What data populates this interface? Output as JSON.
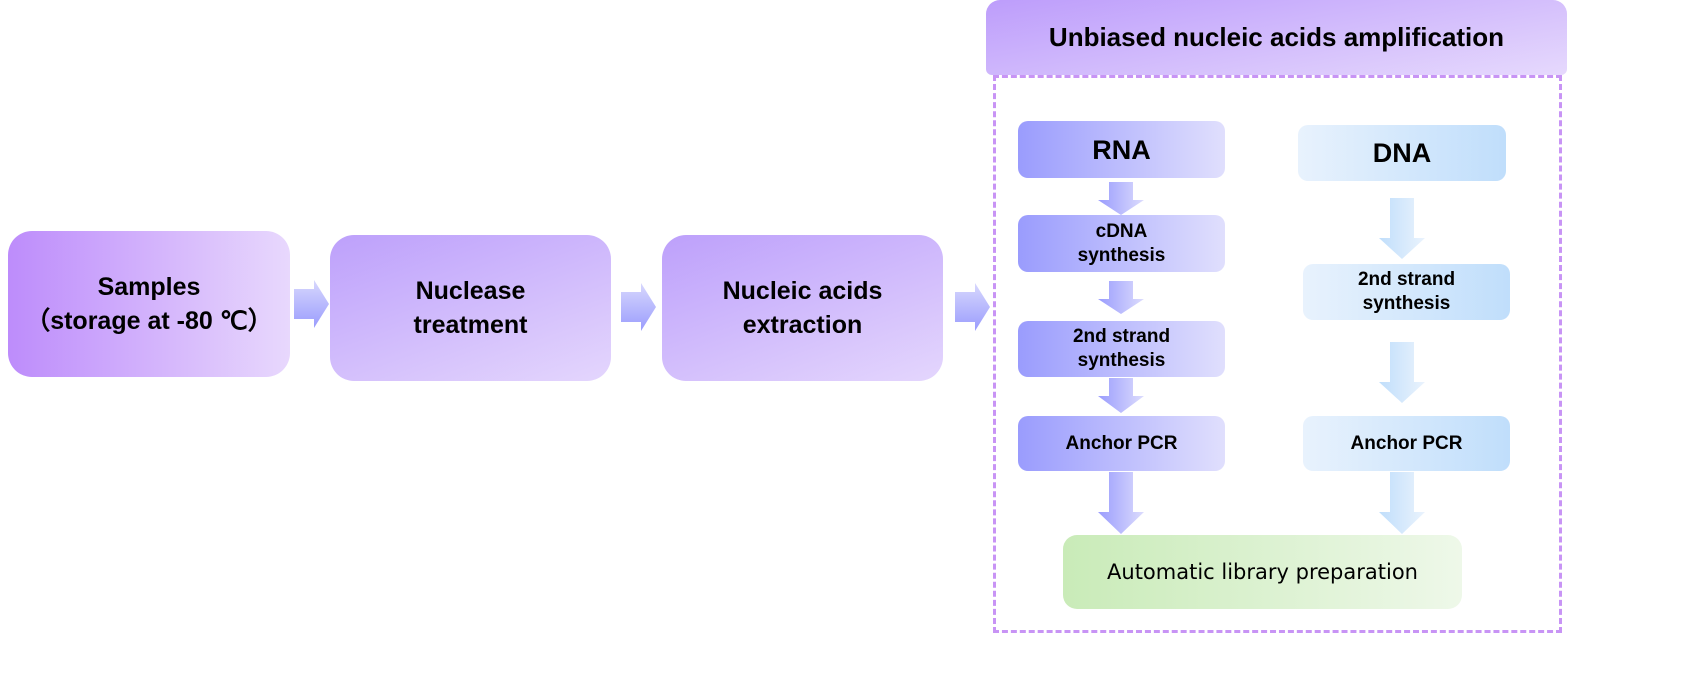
{
  "pipeline": {
    "steps": [
      {
        "line1": "Samples",
        "line2": "（storage at -80 ℃）"
      },
      {
        "line1": "Nuclease",
        "line2": "treatment"
      },
      {
        "line1": "Nucleic acids",
        "line2": "extraction"
      }
    ]
  },
  "amplification": {
    "title": "Unbiased nucleic acids amplification",
    "rna": {
      "label": "RNA",
      "cdna_1": "cDNA",
      "cdna_2": "synthesis",
      "second_1": "2nd strand",
      "second_2": "synthesis",
      "anchor": "Anchor PCR"
    },
    "dna": {
      "label": "DNA",
      "second_1": "2nd strand",
      "second_2": "synthesis",
      "anchor": "Anchor PCR"
    },
    "library": "Automatic library preparation"
  },
  "colors": {
    "purple_start": "#bd8cfb",
    "rna_blue": "#9a9cfd",
    "dna_blue": "#c0defb",
    "green": "#c9ebb8",
    "dashed_border": "#c894f5"
  }
}
